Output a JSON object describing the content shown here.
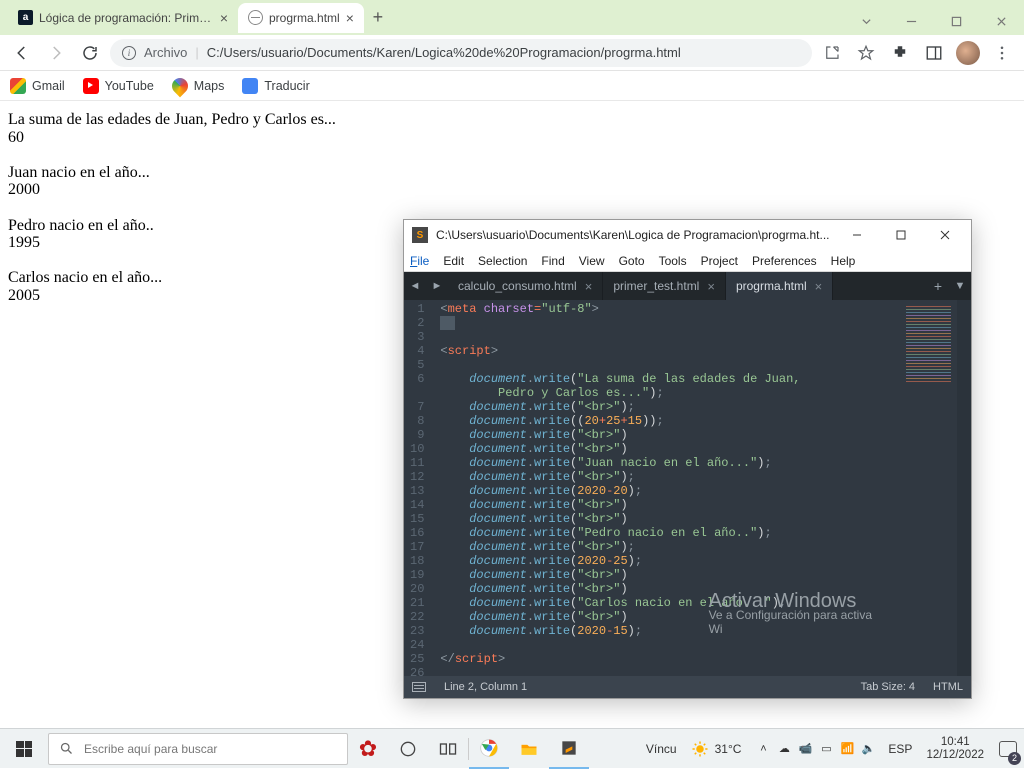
{
  "chrome": {
    "tabs": [
      {
        "title": "Lógica de programación: Primero",
        "active": false
      },
      {
        "title": "progrma.html",
        "active": true
      }
    ],
    "addressbar": {
      "label": "Archivo",
      "path": "C:/Users/usuario/Documents/Karen/Logica%20de%20Programacion/progrma.html"
    },
    "bookmarks": {
      "gmail": "Gmail",
      "youtube": "YouTube",
      "maps": "Maps",
      "traducir": "Traducir"
    }
  },
  "page": {
    "l1": "La suma de las edades de Juan, Pedro y Carlos es...",
    "v1": "60",
    "l2": "Juan nacio en el año...",
    "v2": "2000",
    "l3": "Pedro nacio en el año..",
    "v3": "1995",
    "l4": "Carlos nacio en el año...",
    "v4": "2005"
  },
  "sublime": {
    "titlebar": "C:\\Users\\usuario\\Documents\\Karen\\Logica de Programacion\\progrma.ht...",
    "menu": {
      "file": "File",
      "edit": "Edit",
      "selection": "Selection",
      "find": "Find",
      "view": "View",
      "goto": "Goto",
      "tools": "Tools",
      "project": "Project",
      "preferences": "Preferences",
      "help": "Help"
    },
    "tabs": {
      "t1": "calculo_consumo.html",
      "t2": "primer_test.html",
      "t3": "progrma.html"
    },
    "lines": [
      "1",
      "2",
      "3",
      "4",
      "5",
      "6",
      "",
      "7",
      "8",
      "9",
      "10",
      "11",
      "12",
      "13",
      "14",
      "15",
      "16",
      "17",
      "18",
      "19",
      "20",
      "21",
      "22",
      "23",
      "24",
      "25",
      "26"
    ],
    "code": {
      "l1_tag": "meta",
      "l1_attr": "charset",
      "l1_val": "\"utf-8\"",
      "l4_tag": "script",
      "obj": "document",
      "call": "write",
      "s6": "\"La suma de las edades de Juan, Pedro y Carlos es...\"",
      "sbr": "\"<br>\"",
      "e8": "20+25+15",
      "s11": "\"Juan nacio en el año...\"",
      "e13": "2020-20",
      "s16": "\"Pedro nacio en el año..\"",
      "e18": "2020-25",
      "s21": "\"Carlos nacio en el año...\"",
      "e23": "2020-15",
      "l25_tag": "script"
    },
    "status": {
      "pos": "Line 2, Column 1",
      "tabsize": "Tab Size: 4",
      "syntax": "HTML"
    }
  },
  "watermark": {
    "wm1": "Activar Windows",
    "wm2": "Ve a Configuración para activa",
    "wm3": "Wi"
  },
  "taskbar": {
    "search_placeholder": "Escribe aquí para buscar",
    "vincu": "Víncu",
    "temp": "31°C",
    "lang": "ESP",
    "time": "10:41",
    "date": "12/12/2022",
    "notif_count": "2"
  }
}
